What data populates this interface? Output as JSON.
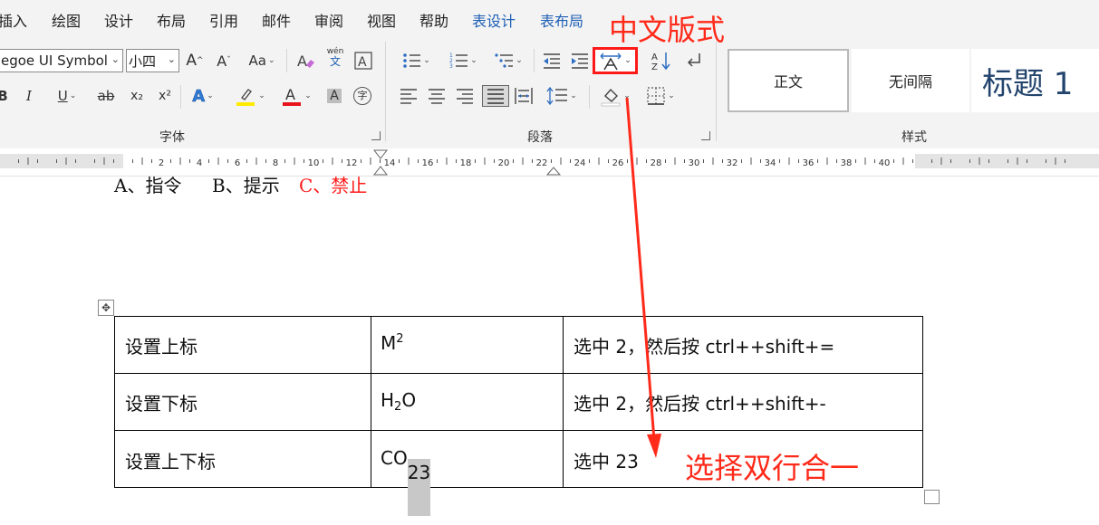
{
  "menu": {
    "tabs": [
      "插入",
      "绘图",
      "设计",
      "布局",
      "引用",
      "邮件",
      "审阅",
      "视图",
      "帮助"
    ],
    "context_tabs": [
      "表设计",
      "表布局"
    ]
  },
  "ribbon": {
    "font_group": {
      "label": "字体",
      "font_name": "egoe UI Symbol",
      "font_size": "小四",
      "change_case_label": "Aa",
      "phonetic_top": "wén",
      "phonetic_bottom": "文",
      "bold": "B",
      "italic": "I",
      "underline": "U",
      "strike": "ab",
      "subscript_label": "x₂",
      "superscript_label": "x²",
      "text_effect": "A",
      "font_color": "A",
      "char_shading": "A",
      "enclose_char": "字"
    },
    "paragraph_group": {
      "label": "段落"
    },
    "styles_group": {
      "label": "样式",
      "items": [
        "正文",
        "无间隔",
        "标题 1"
      ]
    }
  },
  "ruler": {
    "numbers": [
      "2",
      "4",
      "6",
      "8",
      "10",
      "12",
      "14",
      "16",
      "18",
      "20",
      "22",
      "24",
      "26",
      "28",
      "30",
      "32",
      "34",
      "36",
      "38",
      "40"
    ]
  },
  "document": {
    "partial_line": {
      "a": "A、指令",
      "b": "B、提示",
      "c": "C、禁止"
    },
    "table": {
      "rows": [
        {
          "name": "设置上标",
          "example_base": "M",
          "example_mark": "2",
          "example_rest": "",
          "how": "选中 2，然后按 ctrl++shift+="
        },
        {
          "name": "设置下标",
          "example_base": "H",
          "example_mark": "2",
          "example_rest": "O",
          "how": "选中 2，然后按 ctrl++shift+-"
        },
        {
          "name": "设置上下标",
          "example_base": "CO",
          "example_mark": "23",
          "example_rest": "",
          "how": "选中 23"
        }
      ]
    }
  },
  "annotations": {
    "top": "中文版式",
    "bottom": "选择双行合一"
  },
  "colors": {
    "annotation_red": "#ff2a1a",
    "context_tab_blue": "#1f5fb5",
    "ribbon_bg": "#f3f3f3"
  }
}
